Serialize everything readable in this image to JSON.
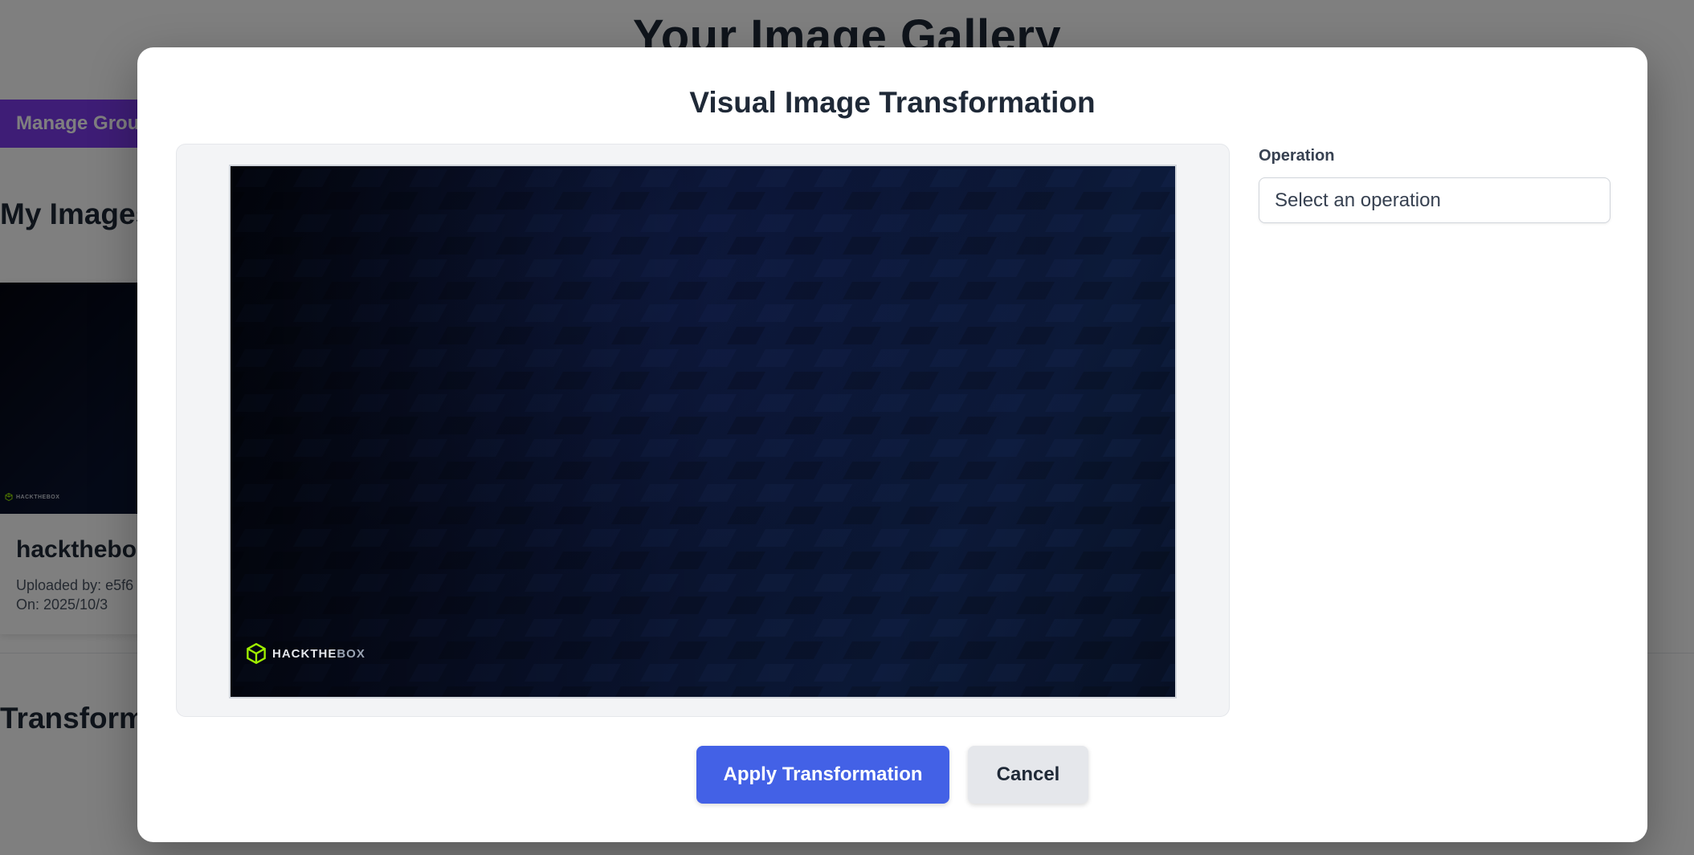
{
  "background": {
    "page_title": "Your Image Gallery",
    "manage_groups_label": "Manage Grou",
    "my_images_heading": "My Images",
    "transform_heading": "Transform",
    "card": {
      "name": "hackthebo",
      "uploaded_by": "Uploaded by: e5f6",
      "uploaded_on": "On: 2025/10/3",
      "logo_text": "HACKTHEBOX"
    }
  },
  "modal": {
    "title": "Visual Image Transformation",
    "preview": {
      "logo_text_main": "HACKTHE",
      "logo_text_dim": "BOX"
    },
    "operation": {
      "label": "Operation",
      "selected": "Select an operation"
    },
    "buttons": {
      "apply": "Apply Transformation",
      "cancel": "Cancel"
    }
  },
  "colors": {
    "accent": "#4361e6",
    "manage_button": "#7c3aed",
    "cancel_button": "#e5e7eb",
    "logo_green": "#9fef00"
  },
  "icons": {
    "logo": "hackthebox-cube-icon",
    "select_arrow": "chevron-down-icon"
  }
}
